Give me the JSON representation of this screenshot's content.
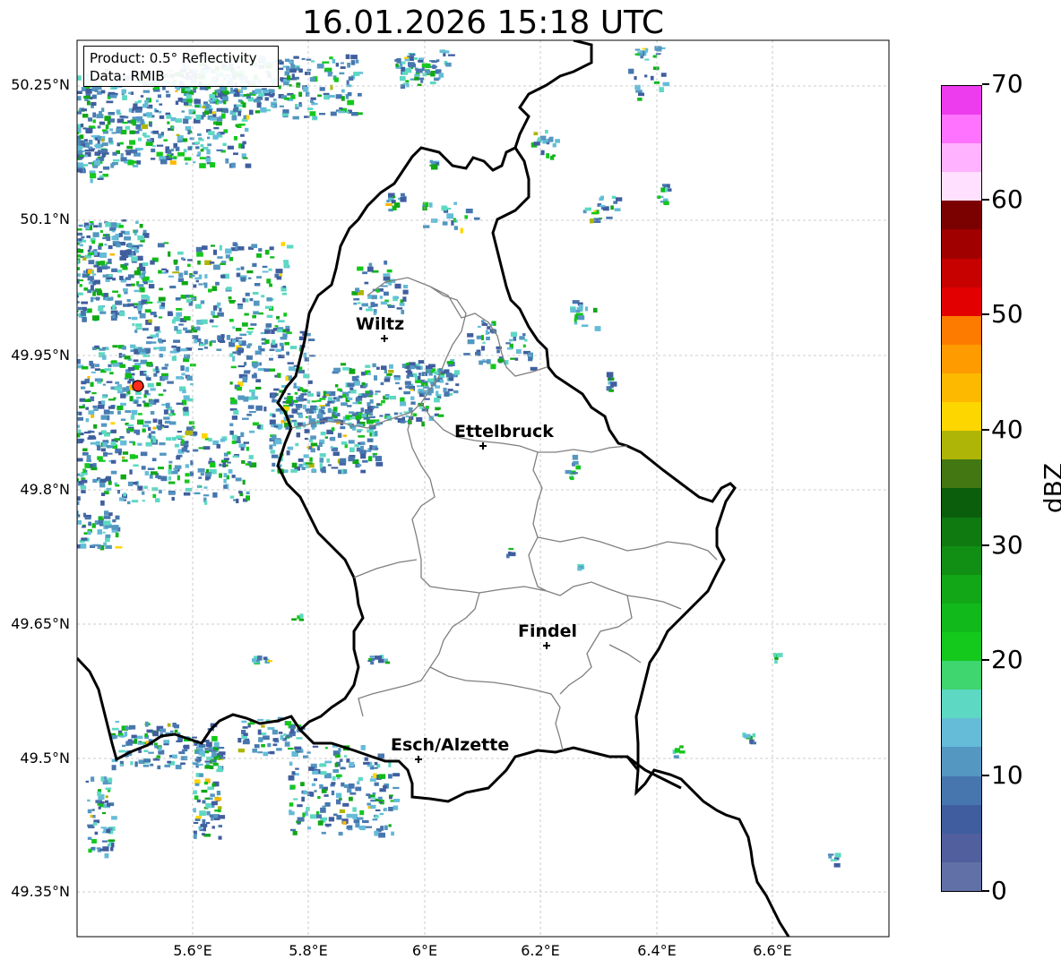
{
  "title": "16.01.2026 15:18 UTC",
  "info_box": {
    "product": "Product: 0.5° Reflectivity",
    "data_source": "Data: RMIB"
  },
  "lat_labels": [
    "50.25°N",
    "50.1°N",
    "49.95°N",
    "49.8°N",
    "49.65°N",
    "49.5°N",
    "49.35°N"
  ],
  "lon_labels": [
    "5.6°E",
    "5.8°E",
    "6°E",
    "6.2°E",
    "6.4°E",
    "6.6°E"
  ],
  "cities": [
    {
      "name": "Wiltz"
    },
    {
      "name": "Ettelbruck"
    },
    {
      "name": "Findel"
    },
    {
      "name": "Esch/Alzette"
    }
  ],
  "radar_marker": "radar-site-icon",
  "colorbar": {
    "label": "dBZ",
    "tick_labels": [
      "0",
      "10",
      "20",
      "30",
      "40",
      "50",
      "60",
      "70"
    ],
    "colors": [
      "#6170a6",
      "#515f9e",
      "#405e9f",
      "#4776ae",
      "#5497c1",
      "#64bcd8",
      "#5dd8c3",
      "#3fd56f",
      "#14c81c",
      "#12b91a",
      "#11a716",
      "#108f14",
      "#0e7a10",
      "#0a5e0c",
      "#437711",
      "#afb506",
      "#fdd600",
      "#fdb800",
      "#fd9b00",
      "#fd7c00",
      "#e20000",
      "#c70000",
      "#a00000",
      "#7b0000",
      "#ffe0ff",
      "#ffb2ff",
      "#ff73ff",
      "#ec3ced"
    ]
  },
  "colors": {
    "country_border": "#000000",
    "canton_border": "#7f7f7f",
    "grid": "#bfbfbf",
    "radar_site": "#ff2a1a"
  }
}
